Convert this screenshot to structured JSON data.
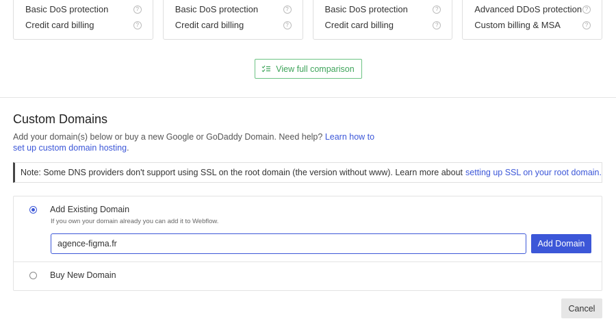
{
  "plans": [
    {
      "features": [
        {
          "label": "Basic DoS protection",
          "help": "?"
        },
        {
          "label": "Credit card billing",
          "help": "?"
        }
      ]
    },
    {
      "features": [
        {
          "label": "Basic DoS protection",
          "help": "?"
        },
        {
          "label": "Credit card billing",
          "help": "?"
        }
      ]
    },
    {
      "features": [
        {
          "label": "Basic DoS protection",
          "help": "?"
        },
        {
          "label": "Credit card billing",
          "help": "?"
        }
      ]
    },
    {
      "features": [
        {
          "label": "Advanced DDoS protection",
          "help": "?"
        },
        {
          "label": "Custom billing & MSA",
          "help": "?"
        }
      ]
    }
  ],
  "comparison": {
    "label": "View full comparison",
    "icon": "checklist-icon"
  },
  "custom_domains": {
    "title": "Custom Domains",
    "intro_text": "Add your domain(s) below or buy a new Google or GoDaddy Domain. Need help?",
    "intro_link": "Learn how to set up custom domain hosting",
    "intro_end": ".",
    "note_text": "Note: Some DNS providers don't support using SSL on the root domain (the version without www). Learn more about",
    "note_link": "setting up SSL on your root domain."
  },
  "options": {
    "existing": {
      "label": "Add Existing Domain",
      "sub": "If you own your domain already you can add it to Webflow.",
      "checked": true,
      "input_value": "agence-figma.fr",
      "button_label": "Add Domain"
    },
    "new": {
      "label": "Buy New Domain",
      "checked": false
    }
  },
  "cancel_label": "Cancel",
  "colors": {
    "accent": "#3c57d8",
    "green": "#3ea45a"
  }
}
